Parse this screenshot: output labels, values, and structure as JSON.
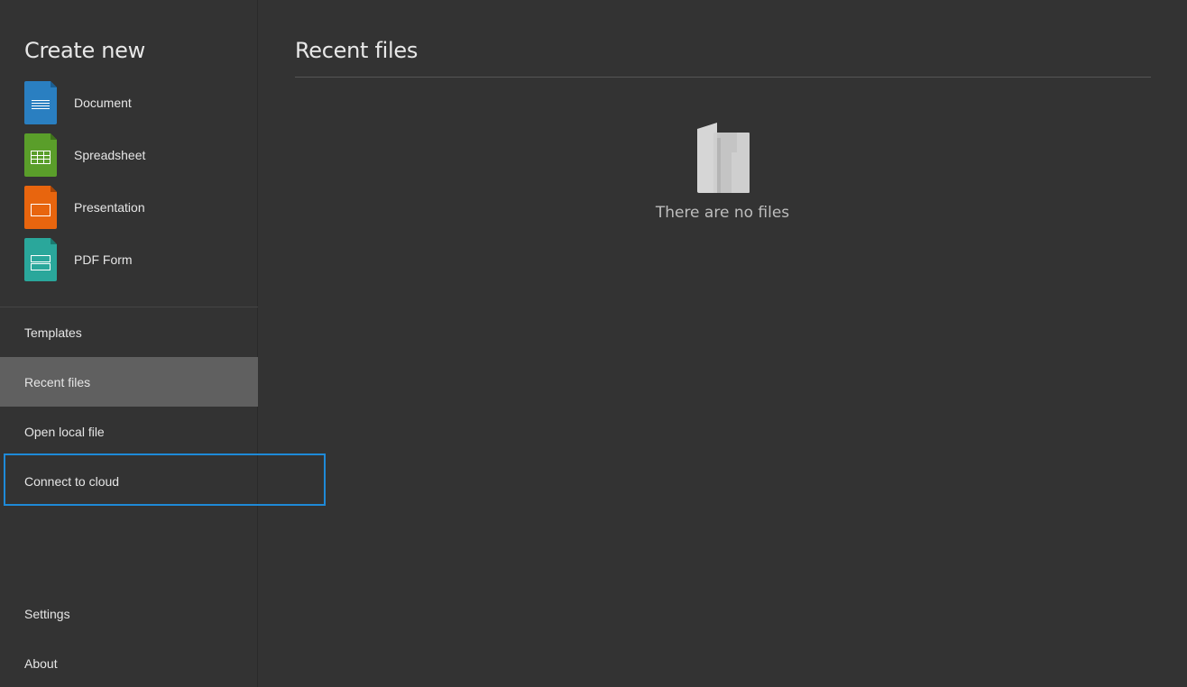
{
  "sidebar": {
    "create_title": "Create new",
    "create_items": [
      {
        "label": "Document",
        "icon": "document-icon",
        "color": "#2a7fc1"
      },
      {
        "label": "Spreadsheet",
        "icon": "spreadsheet-icon",
        "color": "#5a9e2a"
      },
      {
        "label": "Presentation",
        "icon": "presentation-icon",
        "color": "#e8650e"
      },
      {
        "label": "PDF Form",
        "icon": "pdf-form-icon",
        "color": "#2aa79b"
      }
    ],
    "nav": [
      {
        "label": "Templates"
      },
      {
        "label": "Recent files",
        "active": true
      },
      {
        "label": "Open local file"
      },
      {
        "label": "Connect to cloud",
        "focused": true
      },
      {
        "label": "Settings"
      },
      {
        "label": "About"
      }
    ]
  },
  "main": {
    "title": "Recent files",
    "empty_text": "There are no files",
    "empty_icon": "empty-folder-icon"
  },
  "colors": {
    "background": "#333333",
    "active_item": "#606060",
    "focus_ring": "#1e8ad8"
  }
}
